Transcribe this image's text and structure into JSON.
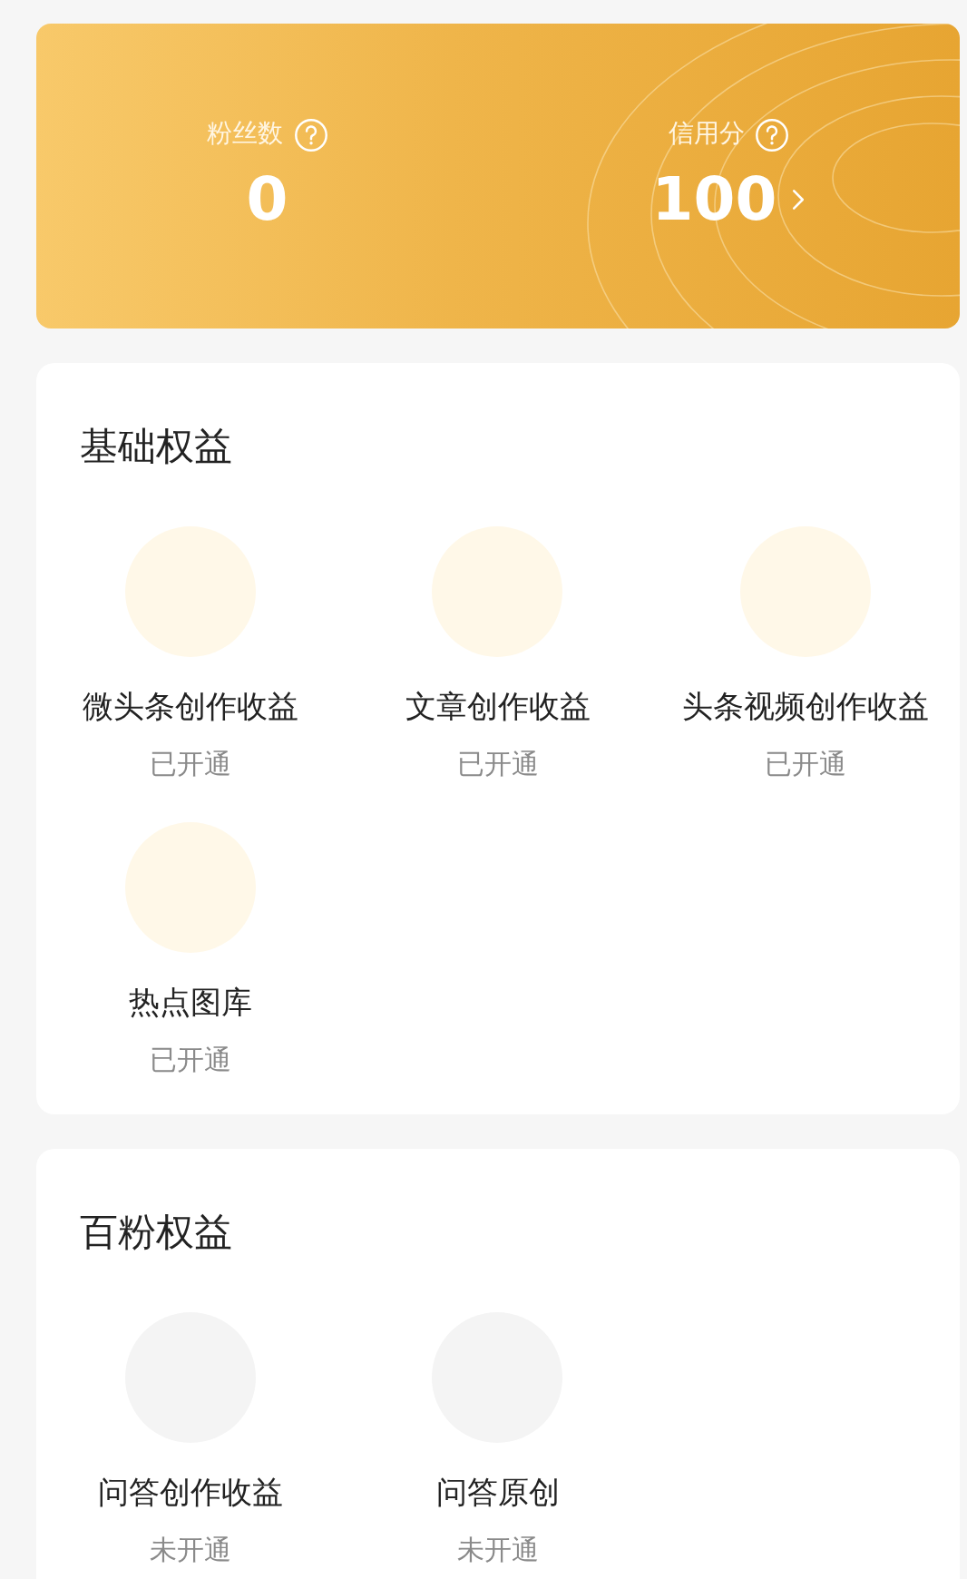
{
  "stats": [
    {
      "label": "粉丝数",
      "value": "0",
      "link": false
    },
    {
      "label": "信用分",
      "value": "100",
      "link": true
    }
  ],
  "sections": [
    {
      "title": "基础权益",
      "items": [
        {
          "name": "微头条创作收益",
          "status": "已开通",
          "opened": true
        },
        {
          "name": "文章创作收益",
          "status": "已开通",
          "opened": true
        },
        {
          "name": "头条视频创作收益",
          "status": "已开通",
          "opened": true
        },
        {
          "name": "热点图库",
          "status": "已开通",
          "opened": true
        }
      ]
    },
    {
      "title": "百粉权益",
      "items": [
        {
          "name": "问答创作收益",
          "status": "未开通",
          "opened": false
        },
        {
          "name": "问答原创",
          "status": "未开通",
          "opened": false
        }
      ]
    }
  ]
}
